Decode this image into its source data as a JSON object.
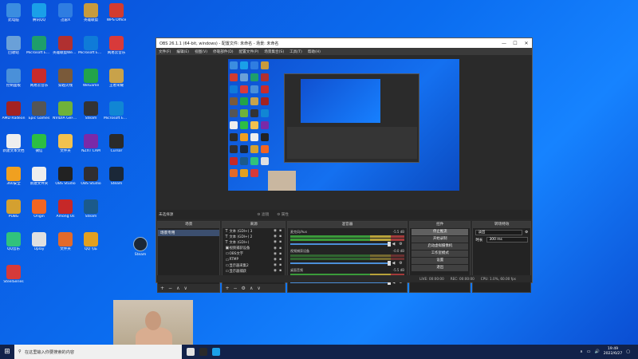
{
  "desktop": {
    "icons": [
      {
        "label": "此电脑",
        "color": "#3b8de0"
      },
      {
        "label": "腾讯QQ",
        "color": "#1aa0e8"
      },
      {
        "label": "迅雷X",
        "color": "#2f7de1"
      },
      {
        "label": "英雄联盟",
        "color": "#c89b3c"
      },
      {
        "label": "WPS Office",
        "color": "#d23b30"
      },
      {
        "label": "回收站",
        "color": "#6aa0d8"
      },
      {
        "label": "Microsoft Edge",
        "color": "#1e9e6b"
      },
      {
        "label": "英雄联盟WeGame",
        "color": "#b03030"
      },
      {
        "label": "Microsoft Edge",
        "color": "#0f7bd8"
      },
      {
        "label": "网易云音乐",
        "color": "#d83a3a"
      },
      {
        "label": "控制面板",
        "color": "#4a90d9"
      },
      {
        "label": "网易云音乐",
        "color": "#c92b2b"
      },
      {
        "label": "穿越火线",
        "color": "#7a5a3a"
      },
      {
        "label": "WeGame",
        "color": "#22a34a"
      },
      {
        "label": "王者荣耀",
        "color": "#c8a24a"
      },
      {
        "label": "AMD Radeon",
        "color": "#a32222"
      },
      {
        "label": "Epic Games",
        "color": "#555555"
      },
      {
        "label": "NVIDIA GeForce",
        "color": "#6fb23a"
      },
      {
        "label": "Steam",
        "color": "#333333"
      },
      {
        "label": "Microsoft Edge",
        "color": "#1186d4"
      },
      {
        "label": "新建文本文档",
        "color": "#eeeeee"
      },
      {
        "label": "微信",
        "color": "#2cbe43"
      },
      {
        "label": "文件夹",
        "color": "#f2c14e"
      },
      {
        "label": "NZXT CAM",
        "color": "#7a2aa8"
      },
      {
        "label": "Cursor",
        "color": "#2a2a2a"
      },
      {
        "label": "360安全",
        "color": "#f0a020"
      },
      {
        "label": "新建文件夹",
        "color": "#eeeeee"
      },
      {
        "label": "OBS Studio",
        "color": "#222222"
      },
      {
        "label": "OBS Studio",
        "color": "#302e31"
      },
      {
        "label": "Steam",
        "color": "#1b2838"
      },
      {
        "label": "PUBG",
        "color": "#d4a030"
      },
      {
        "label": "Origin",
        "color": "#f26522"
      },
      {
        "label": "Among Us",
        "color": "#c62828"
      },
      {
        "label": "Steam",
        "color": "#1b5a8a"
      },
      {
        "label": "QQ音乐",
        "color": "#31c27c"
      },
      {
        "label": "Uplay",
        "color": "#e0e0e0"
      },
      {
        "label": "文件夹",
        "color": "#e26a2a"
      },
      {
        "label": "QQ飞车",
        "color": "#e2a020"
      },
      {
        "label": "SteelSeries",
        "color": "#d63a3a"
      }
    ],
    "steam_label": "Steam"
  },
  "obs": {
    "title": "OBS 26.1.1 (64-bit, windows) - 配置文件: 未命名 - 场景: 未命名",
    "window_buttons": {
      "minimize": "—",
      "maximize": "☐",
      "close": "✕"
    },
    "menu": [
      "文件(F)",
      "编辑(E)",
      "视图(V)",
      "停靠部件(D)",
      "配置文件(P)",
      "场景集合(S)",
      "工具(T)",
      "帮助(H)"
    ],
    "scene_bar": {
      "current": "未选择源",
      "filter_label": "滤镜",
      "props_label": "属性"
    },
    "docks": {
      "scenes": {
        "title": "场景",
        "items": [
          "场景专用"
        ]
      },
      "sources": {
        "title": "来源",
        "items": [
          {
            "icon": "T",
            "label": "文本 (GDI+) 3"
          },
          {
            "icon": "T",
            "label": "文本 (GDI+) 2"
          },
          {
            "icon": "T",
            "label": "文本 (GDI+)"
          },
          {
            "icon": "▣",
            "label": "视频捕获设备"
          },
          {
            "icon": "▭",
            "label": "OBS文字"
          },
          {
            "icon": "▭",
            "label": "RTMP"
          },
          {
            "icon": "▭",
            "label": "显示器采集2"
          },
          {
            "icon": "▭",
            "label": "显示器捕获"
          }
        ]
      },
      "mixer": {
        "title": "混音器",
        "channels": [
          {
            "name": "麦克风/Aux",
            "db": "-5.5 dB",
            "meter": "full"
          },
          {
            "name": "视频捕获设备",
            "db": "-0.0 dB",
            "meter": "dim"
          },
          {
            "name": "桌面音频",
            "db": "-5.5 dB",
            "meter": "full"
          }
        ]
      },
      "controls": {
        "title": "控件",
        "buttons": [
          "停止推流",
          "开始录制",
          "启动虚拟摄像机",
          "工作室模式",
          "设置",
          "退出"
        ]
      },
      "transitions": {
        "title": "转场特效",
        "type": "淡出",
        "duration_label": "时长",
        "duration_value": "300 ms"
      }
    },
    "footer_icons": {
      "add": "+",
      "remove": "−",
      "settings": "⚙",
      "up": "∧",
      "down": "∨"
    },
    "status": {
      "live_label": "LIVE:",
      "live_time": "00:00:00",
      "rec_label": "REC:",
      "rec_time": "00:00:00",
      "cpu": "CPU: 1.0%, 60.00 fps"
    }
  },
  "taskbar": {
    "search_placeholder": "在这里输入你要搜索的内容",
    "time": "19:49",
    "date": "2022/6/27",
    "app_colors": [
      "#e0e0e0",
      "#2a2a2a",
      "#1aa0e8"
    ]
  }
}
